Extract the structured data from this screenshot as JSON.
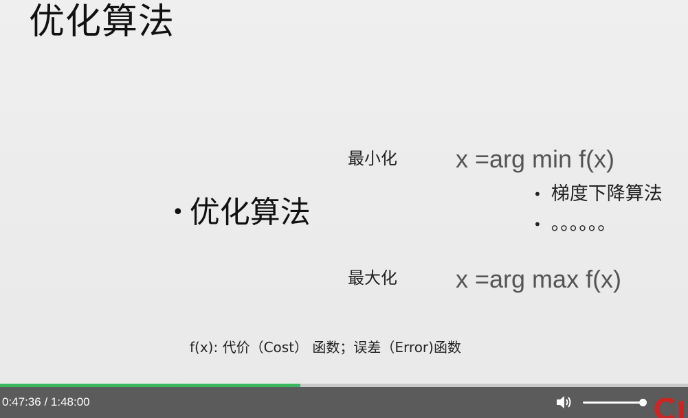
{
  "slide": {
    "title": "优化算法",
    "main_bullet": "优化算法",
    "minimize": {
      "label": "最小化",
      "formula": "x =arg min f(x)"
    },
    "sub_bullets": [
      "梯度下降算法",
      "。。。。。。"
    ],
    "maximize": {
      "label": "最大化",
      "formula": "x =arg max f(x)"
    },
    "footnote": "f(x): 代价（Cost） 函数；误差（Error)函数"
  },
  "player": {
    "time": "0:47:36 / 1:48:00",
    "progress_fraction": 0.437,
    "volume_fraction": 1.0,
    "progress_color": "#3bb85f",
    "bar_color": "#5b5b5b",
    "logo_color": "#c62828",
    "icons": {
      "volume": "volume-icon",
      "logo": "logo-icon"
    }
  }
}
